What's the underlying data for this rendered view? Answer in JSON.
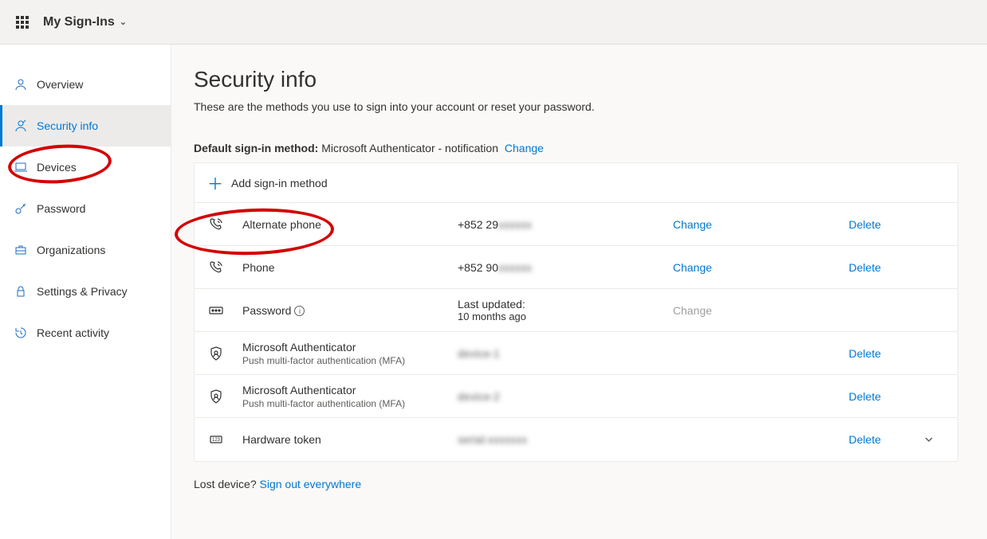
{
  "header": {
    "brand": "My Sign-Ins"
  },
  "sidebar": {
    "items": [
      {
        "label": "Overview",
        "icon": "person-icon"
      },
      {
        "label": "Security info",
        "icon": "key-icon",
        "selected": true
      },
      {
        "label": "Devices",
        "icon": "laptop-icon"
      },
      {
        "label": "Password",
        "icon": "key-icon"
      },
      {
        "label": "Organizations",
        "icon": "briefcase-icon"
      },
      {
        "label": "Settings & Privacy",
        "icon": "lock-icon"
      },
      {
        "label": "Recent activity",
        "icon": "history-icon"
      }
    ]
  },
  "page": {
    "title": "Security info",
    "description": "These are the methods you use to sign into your account or reset your password.",
    "defaultLabel": "Default sign-in method:",
    "defaultValue": "Microsoft Authenticator - notification",
    "changeLabel": "Change",
    "addLabel": "Add sign-in method",
    "lostLabel": "Lost device?",
    "signOutLabel": "Sign out everywhere"
  },
  "methods": [
    {
      "name": "Alternate phone",
      "sub": "",
      "value_prefix": "+852 29",
      "value_hidden": "xxxxxx",
      "change": "Change",
      "delete": "Delete",
      "icon": "phone-call-icon"
    },
    {
      "name": "Phone",
      "sub": "",
      "value_prefix": "+852 90",
      "value_hidden": "xxxxxx",
      "change": "Change",
      "delete": "Delete",
      "icon": "phone-call-icon"
    },
    {
      "name": "Password",
      "sub": "",
      "value_prefix": "Last updated:",
      "value_line2": "10 months ago",
      "change": "Change",
      "change_disabled": true,
      "icon": "password-icon",
      "info": true
    },
    {
      "name": "Microsoft Authenticator",
      "sub": "Push multi-factor authentication (MFA)",
      "value_hidden": "device-1",
      "delete": "Delete",
      "icon": "authenticator-icon"
    },
    {
      "name": "Microsoft Authenticator",
      "sub": "Push multi-factor authentication (MFA)",
      "value_hidden": "device-2",
      "delete": "Delete",
      "icon": "authenticator-icon"
    },
    {
      "name": "Hardware token",
      "sub": "",
      "value_hidden": "serial-xxxxxxx",
      "delete": "Delete",
      "icon": "token-icon",
      "expandable": true
    }
  ]
}
